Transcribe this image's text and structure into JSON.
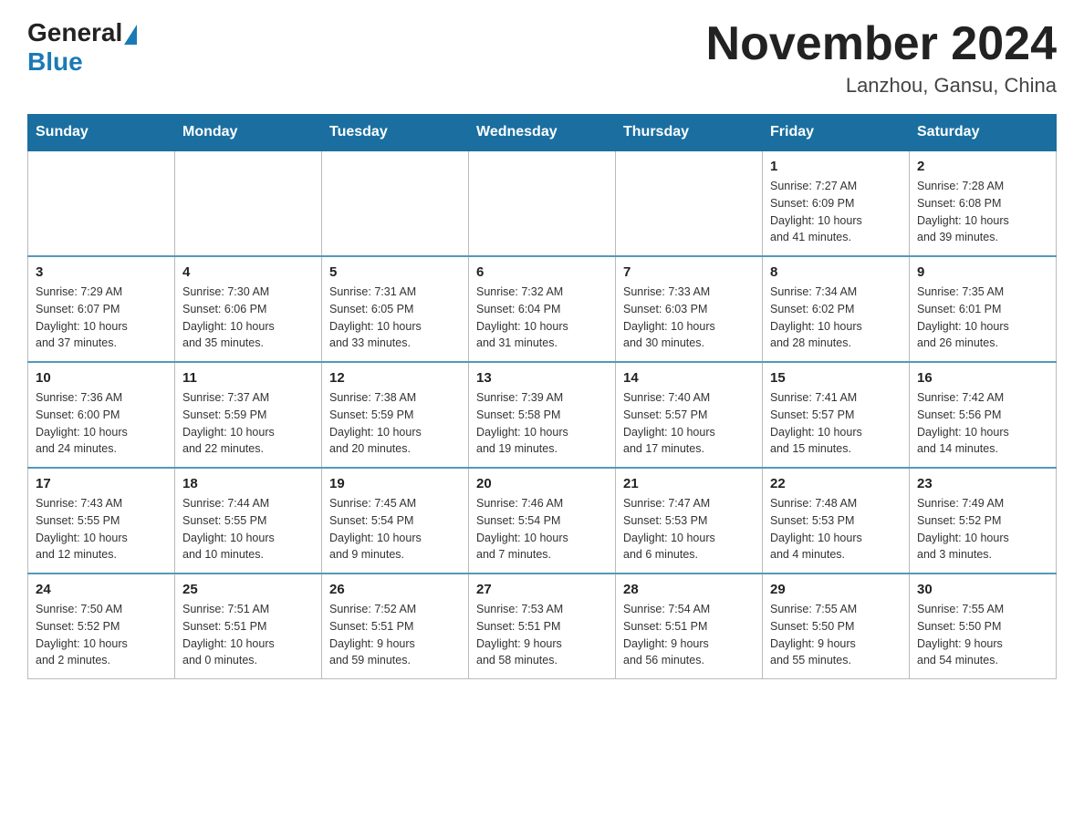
{
  "header": {
    "logo_general": "General",
    "logo_blue": "Blue",
    "title": "November 2024",
    "subtitle": "Lanzhou, Gansu, China"
  },
  "weekdays": [
    "Sunday",
    "Monday",
    "Tuesday",
    "Wednesday",
    "Thursday",
    "Friday",
    "Saturday"
  ],
  "weeks": [
    [
      {
        "day": "",
        "info": ""
      },
      {
        "day": "",
        "info": ""
      },
      {
        "day": "",
        "info": ""
      },
      {
        "day": "",
        "info": ""
      },
      {
        "day": "",
        "info": ""
      },
      {
        "day": "1",
        "info": "Sunrise: 7:27 AM\nSunset: 6:09 PM\nDaylight: 10 hours\nand 41 minutes."
      },
      {
        "day": "2",
        "info": "Sunrise: 7:28 AM\nSunset: 6:08 PM\nDaylight: 10 hours\nand 39 minutes."
      }
    ],
    [
      {
        "day": "3",
        "info": "Sunrise: 7:29 AM\nSunset: 6:07 PM\nDaylight: 10 hours\nand 37 minutes."
      },
      {
        "day": "4",
        "info": "Sunrise: 7:30 AM\nSunset: 6:06 PM\nDaylight: 10 hours\nand 35 minutes."
      },
      {
        "day": "5",
        "info": "Sunrise: 7:31 AM\nSunset: 6:05 PM\nDaylight: 10 hours\nand 33 minutes."
      },
      {
        "day": "6",
        "info": "Sunrise: 7:32 AM\nSunset: 6:04 PM\nDaylight: 10 hours\nand 31 minutes."
      },
      {
        "day": "7",
        "info": "Sunrise: 7:33 AM\nSunset: 6:03 PM\nDaylight: 10 hours\nand 30 minutes."
      },
      {
        "day": "8",
        "info": "Sunrise: 7:34 AM\nSunset: 6:02 PM\nDaylight: 10 hours\nand 28 minutes."
      },
      {
        "day": "9",
        "info": "Sunrise: 7:35 AM\nSunset: 6:01 PM\nDaylight: 10 hours\nand 26 minutes."
      }
    ],
    [
      {
        "day": "10",
        "info": "Sunrise: 7:36 AM\nSunset: 6:00 PM\nDaylight: 10 hours\nand 24 minutes."
      },
      {
        "day": "11",
        "info": "Sunrise: 7:37 AM\nSunset: 5:59 PM\nDaylight: 10 hours\nand 22 minutes."
      },
      {
        "day": "12",
        "info": "Sunrise: 7:38 AM\nSunset: 5:59 PM\nDaylight: 10 hours\nand 20 minutes."
      },
      {
        "day": "13",
        "info": "Sunrise: 7:39 AM\nSunset: 5:58 PM\nDaylight: 10 hours\nand 19 minutes."
      },
      {
        "day": "14",
        "info": "Sunrise: 7:40 AM\nSunset: 5:57 PM\nDaylight: 10 hours\nand 17 minutes."
      },
      {
        "day": "15",
        "info": "Sunrise: 7:41 AM\nSunset: 5:57 PM\nDaylight: 10 hours\nand 15 minutes."
      },
      {
        "day": "16",
        "info": "Sunrise: 7:42 AM\nSunset: 5:56 PM\nDaylight: 10 hours\nand 14 minutes."
      }
    ],
    [
      {
        "day": "17",
        "info": "Sunrise: 7:43 AM\nSunset: 5:55 PM\nDaylight: 10 hours\nand 12 minutes."
      },
      {
        "day": "18",
        "info": "Sunrise: 7:44 AM\nSunset: 5:55 PM\nDaylight: 10 hours\nand 10 minutes."
      },
      {
        "day": "19",
        "info": "Sunrise: 7:45 AM\nSunset: 5:54 PM\nDaylight: 10 hours\nand 9 minutes."
      },
      {
        "day": "20",
        "info": "Sunrise: 7:46 AM\nSunset: 5:54 PM\nDaylight: 10 hours\nand 7 minutes."
      },
      {
        "day": "21",
        "info": "Sunrise: 7:47 AM\nSunset: 5:53 PM\nDaylight: 10 hours\nand 6 minutes."
      },
      {
        "day": "22",
        "info": "Sunrise: 7:48 AM\nSunset: 5:53 PM\nDaylight: 10 hours\nand 4 minutes."
      },
      {
        "day": "23",
        "info": "Sunrise: 7:49 AM\nSunset: 5:52 PM\nDaylight: 10 hours\nand 3 minutes."
      }
    ],
    [
      {
        "day": "24",
        "info": "Sunrise: 7:50 AM\nSunset: 5:52 PM\nDaylight: 10 hours\nand 2 minutes."
      },
      {
        "day": "25",
        "info": "Sunrise: 7:51 AM\nSunset: 5:51 PM\nDaylight: 10 hours\nand 0 minutes."
      },
      {
        "day": "26",
        "info": "Sunrise: 7:52 AM\nSunset: 5:51 PM\nDaylight: 9 hours\nand 59 minutes."
      },
      {
        "day": "27",
        "info": "Sunrise: 7:53 AM\nSunset: 5:51 PM\nDaylight: 9 hours\nand 58 minutes."
      },
      {
        "day": "28",
        "info": "Sunrise: 7:54 AM\nSunset: 5:51 PM\nDaylight: 9 hours\nand 56 minutes."
      },
      {
        "day": "29",
        "info": "Sunrise: 7:55 AM\nSunset: 5:50 PM\nDaylight: 9 hours\nand 55 minutes."
      },
      {
        "day": "30",
        "info": "Sunrise: 7:55 AM\nSunset: 5:50 PM\nDaylight: 9 hours\nand 54 minutes."
      }
    ]
  ]
}
